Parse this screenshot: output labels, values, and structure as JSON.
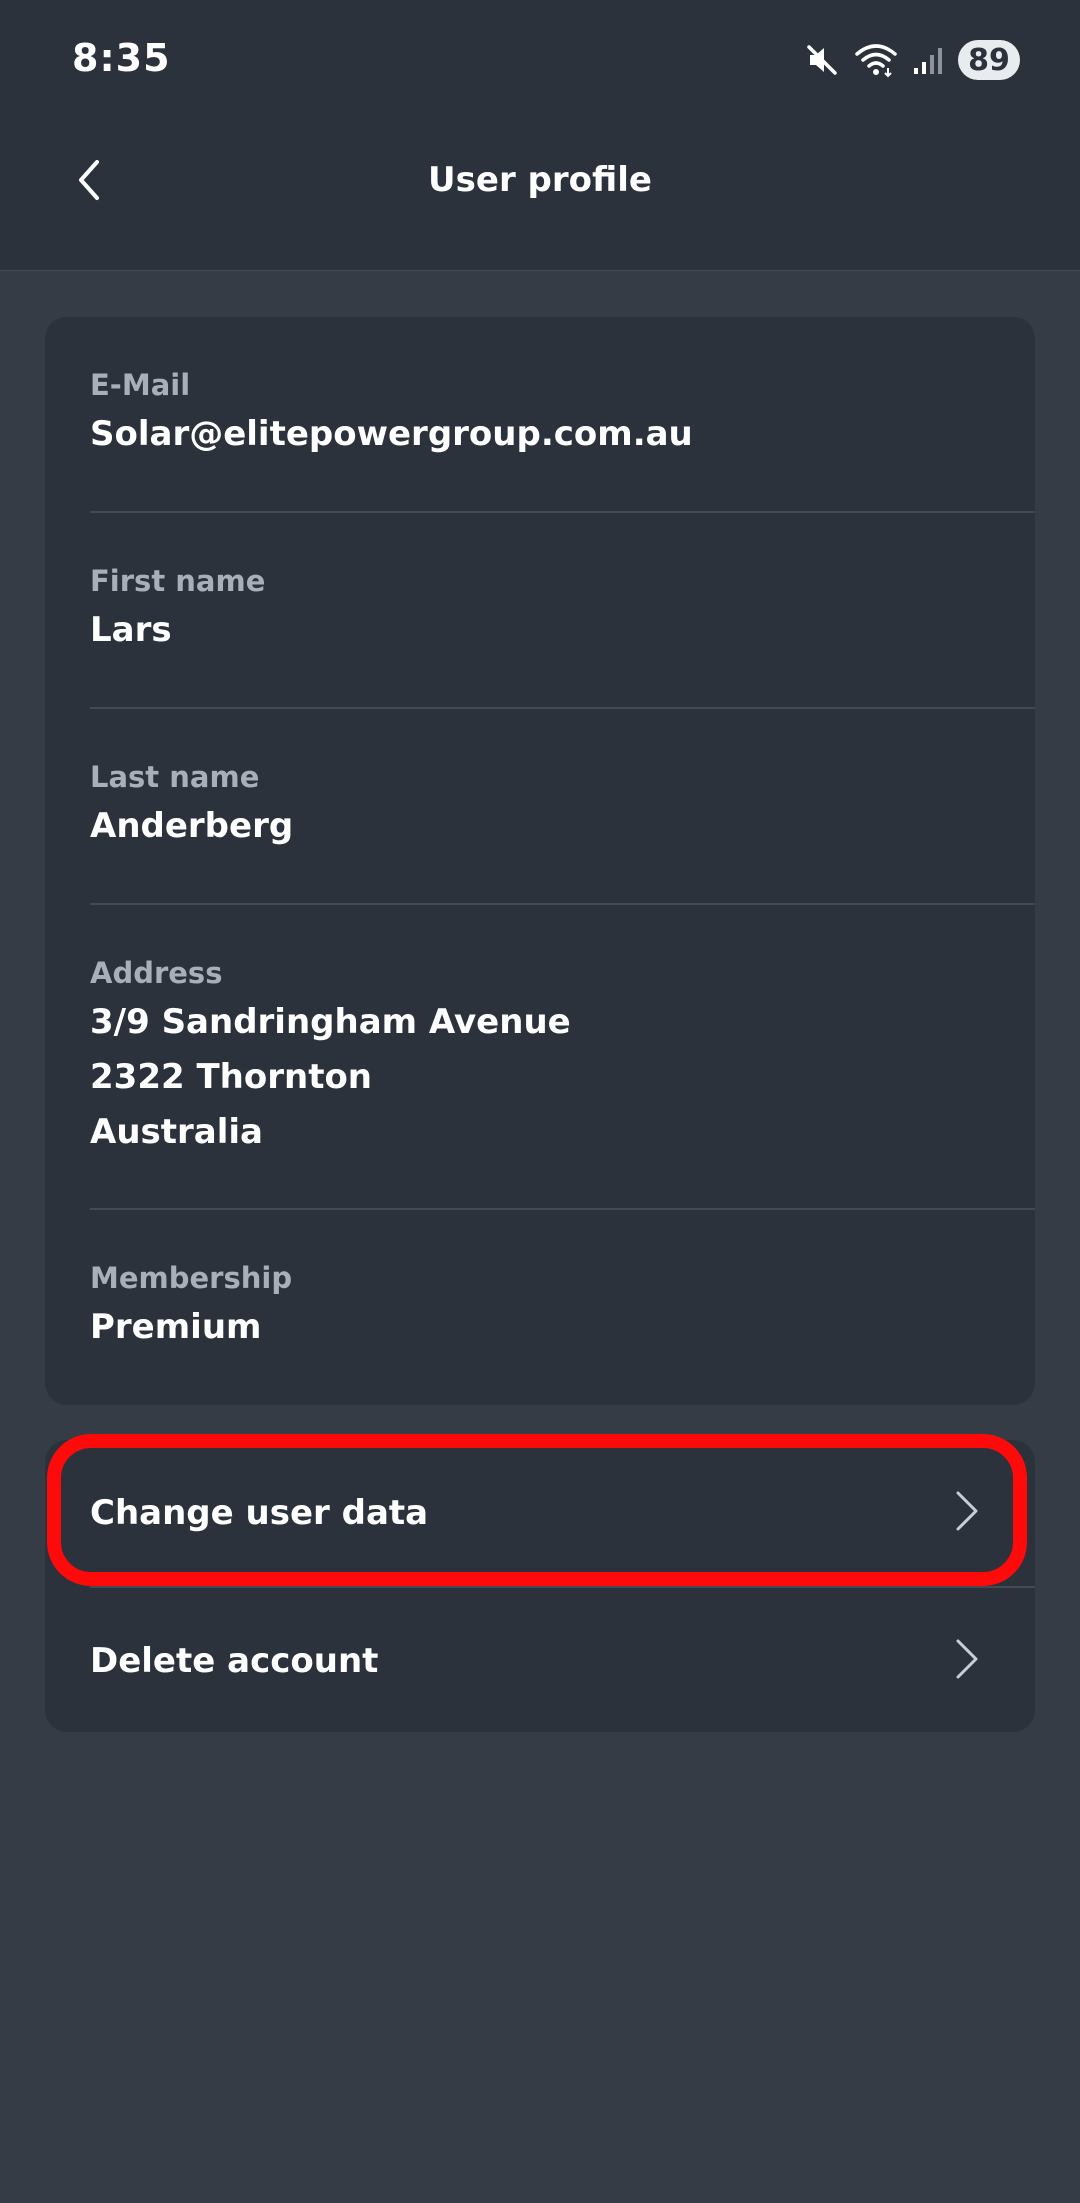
{
  "status_bar": {
    "time": "8:35",
    "battery": "89",
    "icons": [
      "mute-icon",
      "wifi-icon",
      "signal-icon"
    ]
  },
  "header": {
    "title": "User profile",
    "back_icon": "chevron-left-icon"
  },
  "profile": {
    "email": {
      "label": "E-Mail",
      "value": "Solar@elitepowergroup.com.au"
    },
    "first_name": {
      "label": "First name",
      "value": "Lars"
    },
    "last_name": {
      "label": "Last name",
      "value": "Anderberg"
    },
    "address": {
      "label": "Address",
      "lines": [
        "3/9 Sandringham Avenue",
        "2322 Thornton",
        "Australia"
      ]
    },
    "membership": {
      "label": "Membership",
      "value": "Premium"
    }
  },
  "actions": {
    "change_user_data": "Change user data",
    "delete_account": "Delete account"
  },
  "colors": {
    "background": "#363c45",
    "card": "#2b323c",
    "divider": "#434a54",
    "label": "#a9afb8",
    "highlight": "#ff0a0a"
  }
}
